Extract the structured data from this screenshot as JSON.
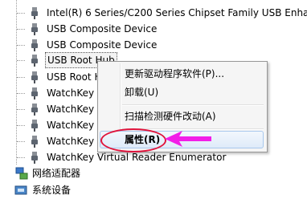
{
  "devices": [
    {
      "label": "Intel(R) 6 Series/C200 Series Chipset Family USB Enha",
      "icon": "usb-plug-icon"
    },
    {
      "label": "USB Composite Device",
      "icon": "usb-plug-icon"
    },
    {
      "label": "USB Composite Device",
      "icon": "usb-plug-icon"
    },
    {
      "label": "USB Root Hub",
      "icon": "usb-plug-icon",
      "selected": true
    },
    {
      "label": "USB Root Hub",
      "icon": "usb-plug-icon"
    },
    {
      "label": "WatchKey",
      "icon": "usb-plug-icon"
    },
    {
      "label": "WatchKey",
      "icon": "usb-plug-icon"
    },
    {
      "label": "WatchKey",
      "icon": "usb-plug-icon"
    },
    {
      "label": "WatchKey",
      "icon": "usb-plug-icon"
    },
    {
      "label": "WatchKey Virtual Reader Enumerator",
      "icon": "usb-plug-icon"
    }
  ],
  "categories": [
    {
      "label": "网络适配器",
      "icon": "network-adapter-icon"
    },
    {
      "label": "系统设备",
      "icon": "system-devices-icon"
    }
  ],
  "context_menu": {
    "update_driver": "更新驱动程序软件(P)...",
    "uninstall": "卸载(U)",
    "scan_hardware": "扫描检测硬件改动(A)",
    "properties": "属性(R)"
  },
  "colors": {
    "annotation": "#e0143c",
    "arrow": "#f21ee8"
  }
}
